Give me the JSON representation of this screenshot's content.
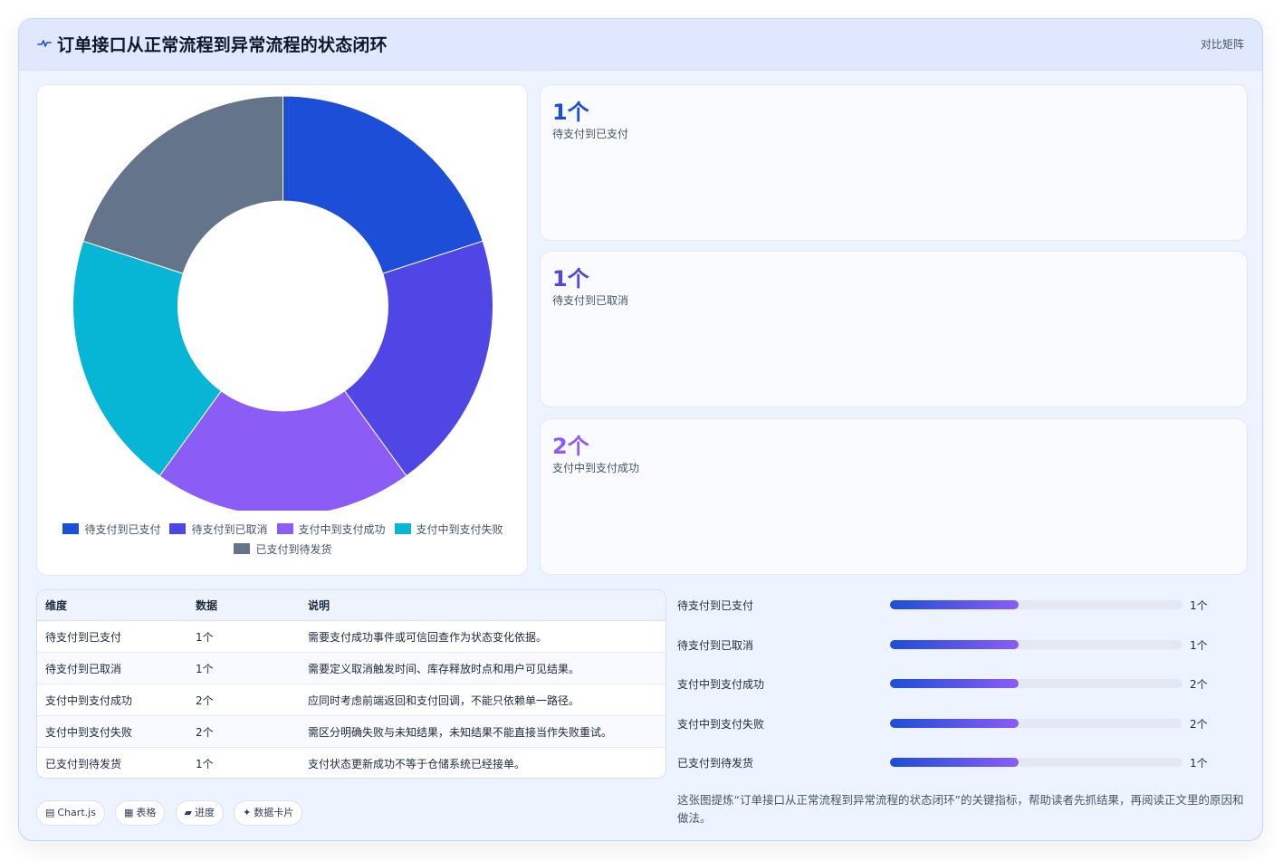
{
  "header": {
    "title": "订单接口从正常流程到异常流程的状态闭环",
    "tag": "对比矩阵"
  },
  "colors": {
    "accent": "#1d4ed8",
    "series": [
      "#1d4ed8",
      "#4f46e5",
      "#8b5cf6",
      "#06b6d4",
      "#64748b"
    ]
  },
  "chart_data": {
    "type": "pie",
    "variant": "doughnut",
    "categories": [
      "待支付到已支付",
      "待支付到已取消",
      "支付中到支付成功",
      "支付中到支付失败",
      "已支付到待发货"
    ],
    "values": [
      1,
      1,
      1,
      1,
      1
    ],
    "colors": [
      "#1d4ed8",
      "#4f46e5",
      "#8b5cf6",
      "#06b6d4",
      "#64748b"
    ],
    "legend_position": "bottom"
  },
  "stats": [
    {
      "value": "1个",
      "label": "待支付到已支付",
      "color": "#1d4ed8"
    },
    {
      "value": "1个",
      "label": "待支付到已取消",
      "color": "#4f46e5"
    },
    {
      "value": "2个",
      "label": "支付中到支付成功",
      "color": "#8b5cf6"
    }
  ],
  "table": {
    "headers": [
      "维度",
      "数据",
      "说明"
    ],
    "rows": [
      [
        "待支付到已支付",
        "1个",
        "需要支付成功事件或可信回查作为状态变化依据。"
      ],
      [
        "待支付到已取消",
        "1个",
        "需要定义取消触发时间、库存释放时点和用户可见结果。"
      ],
      [
        "支付中到支付成功",
        "2个",
        "应同时考虑前端返回和支付回调，不能只依赖单一路径。"
      ],
      [
        "支付中到支付失败",
        "2个",
        "需区分明确失败与未知结果，未知结果不能直接当作失败重试。"
      ],
      [
        "已支付到待发货",
        "1个",
        "支付状态更新成功不等于仓储系统已经接单。"
      ]
    ]
  },
  "progress": [
    {
      "label": "待支付到已支付",
      "value": "1个",
      "fraction": 0.44
    },
    {
      "label": "待支付到已取消",
      "value": "1个",
      "fraction": 0.44
    },
    {
      "label": "支付中到支付成功",
      "value": "2个",
      "fraction": 0.44
    },
    {
      "label": "支付中到支付失败",
      "value": "2个",
      "fraction": 0.44
    },
    {
      "label": "已支付到待发货",
      "value": "1个",
      "fraction": 0.44
    }
  ],
  "chips": [
    {
      "icon": "▤",
      "label": "Chart.js"
    },
    {
      "icon": "▦",
      "label": "表格"
    },
    {
      "icon": "▰",
      "label": "进度"
    },
    {
      "icon": "✦",
      "label": "数据卡片"
    }
  ],
  "footnote": "这张图提炼“订单接口从正常流程到异常流程的状态闭环”的关键指标，帮助读者先抓结果，再阅读正文里的原因和做法。"
}
